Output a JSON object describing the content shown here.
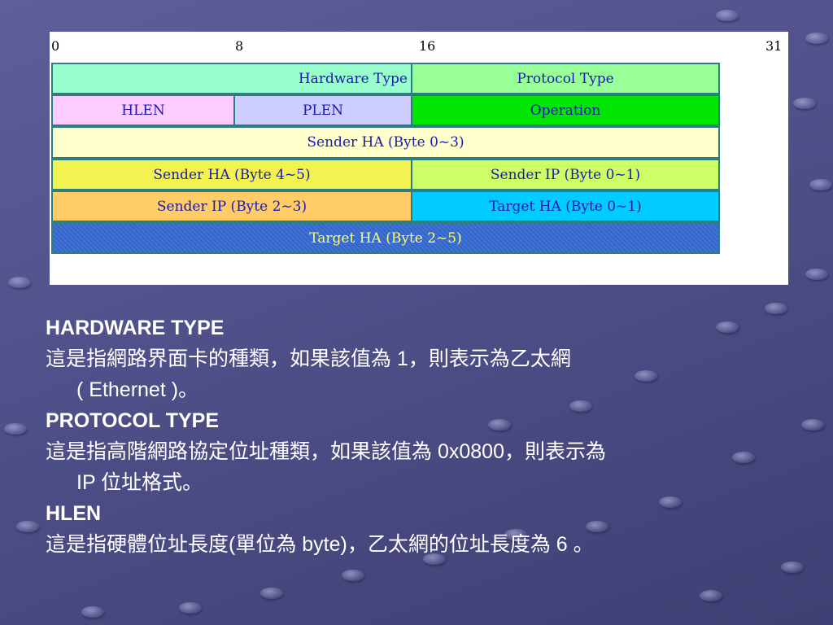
{
  "diagram": {
    "bit_markers": [
      "0",
      "8",
      "16",
      "31"
    ],
    "fields": {
      "hardware_type": "Hardware Type",
      "protocol_type": "Protocol Type",
      "hlen": "HLEN",
      "plen": "PLEN",
      "operation": "Operation",
      "sender_ha_0_3": "Sender HA (Byte 0~3)",
      "sender_ha_4_5": "Sender HA (Byte 4~5)",
      "sender_ip_0_1": "Sender IP (Byte 0~1)",
      "sender_ip_2_3": "Sender IP (Byte 2~3)",
      "target_ha_0_1": "Target HA (Byte 0~1)",
      "target_ha_2_5": "Target HA (Byte 2~5)"
    },
    "colors": {
      "hardware_type": "#99ffcc",
      "protocol_type": "#99ff99",
      "hlen": "#ffccff",
      "plen": "#ccccff",
      "operation": "#00e600",
      "sender_ha_0_3": "#ffffcc",
      "sender_ha_4_5": "#f2f250",
      "sender_ip_0_1": "#ccff66",
      "sender_ip_2_3": "#ffcc66",
      "target_ha_0_1": "#00ccff",
      "target_ha_2_5": "#3366cc"
    }
  },
  "text": {
    "hardware_heading": "HARDWARE TYPE",
    "hardware_desc_1": "這是指網路界面卡的種類，如果該值為 1，則表示為乙太網",
    "hardware_desc_2": "( Ethernet )。",
    "protocol_heading": "PROTOCOL TYPE",
    "protocol_desc_1": "這是指高階網路協定位址種類，如果該值為 0x0800，則表示為",
    "protocol_desc_2": "IP 位址格式。",
    "hlen_heading": "HLEN",
    "hlen_desc": "這是指硬體位址長度(單位為 byte)，乙太網的位址長度為 6 。"
  }
}
